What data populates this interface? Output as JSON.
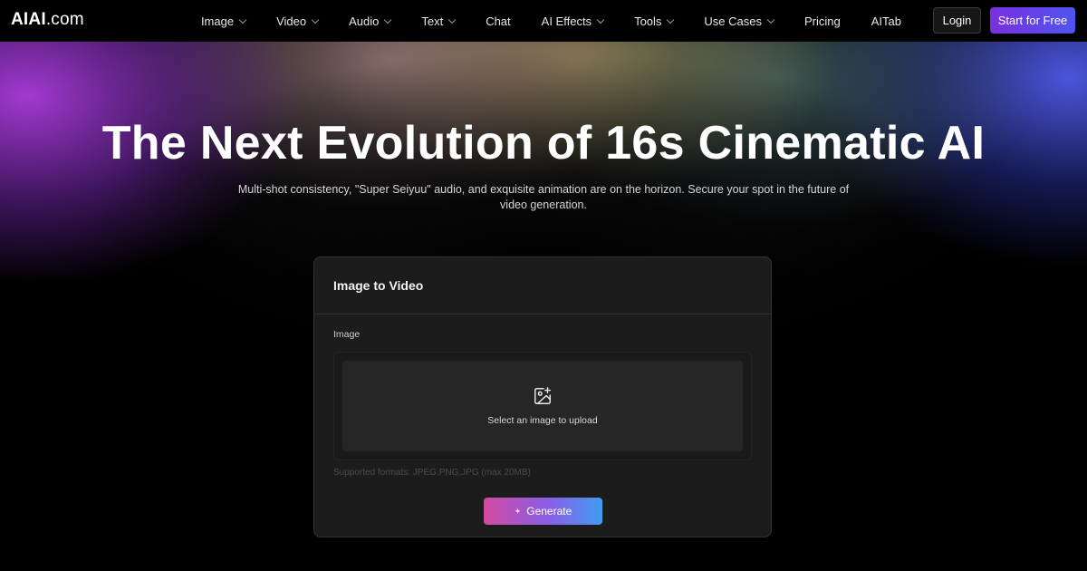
{
  "nav": {
    "logo_main": "AIAI",
    "logo_suffix": ".com",
    "items": [
      {
        "label": "Image",
        "dropdown": true
      },
      {
        "label": "Video",
        "dropdown": true
      },
      {
        "label": "Audio",
        "dropdown": true
      },
      {
        "label": "Text",
        "dropdown": true
      },
      {
        "label": "Chat",
        "dropdown": false
      },
      {
        "label": "AI Effects",
        "dropdown": true
      },
      {
        "label": "Tools",
        "dropdown": true
      },
      {
        "label": "Use Cases",
        "dropdown": true
      },
      {
        "label": "Pricing",
        "dropdown": false
      },
      {
        "label": "AITab",
        "dropdown": false
      }
    ],
    "login_label": "Login",
    "start_label": "Start for Free"
  },
  "hero": {
    "title": "The Next Evolution of 16s Cinematic AI",
    "subtitle": "Multi-shot consistency, \"Super Seiyuu\" audio, and exquisite animation are on the horizon. Secure your spot in the future of video generation."
  },
  "card": {
    "title": "Image to Video",
    "image_label": "Image",
    "upload_text": "Select an image to upload",
    "formats_text": "Supported formats: JPEG,PNG,JPG (max 20MB)",
    "generate_label": "Generate",
    "upload_icon": "image-plus-icon",
    "generate_icon": "sparkle-icon"
  },
  "colors": {
    "start_gradient": [
      "#7a2fe0",
      "#4f55f0"
    ],
    "generate_gradient": [
      "#d14aa0",
      "#8a5ee8",
      "#3f9df0"
    ]
  }
}
